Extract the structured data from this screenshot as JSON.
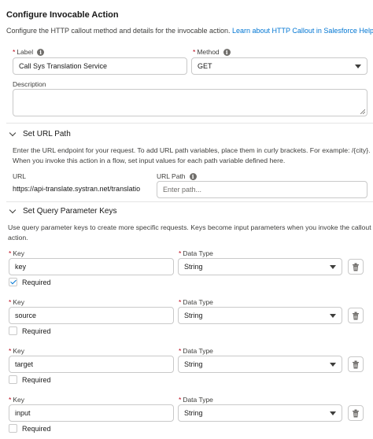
{
  "header": {
    "title": "Configure Invocable Action",
    "description": "Configure the HTTP callout method and details for the invocable action.",
    "help_link": "Learn about HTTP Callout in Salesforce Help."
  },
  "label_field": {
    "label": "Label",
    "value": "Call Sys Translation Service"
  },
  "method_field": {
    "label": "Method",
    "value": "GET"
  },
  "description_field": {
    "label": "Description",
    "value": ""
  },
  "url_section": {
    "title": "Set URL Path",
    "help_line1": "Enter the URL endpoint for your request. To add URL path variables, place them in curly brackets. For example: /{city}.",
    "help_line2": "When you invoke this action in a flow, set input values for each path variable defined here.",
    "url_label": "URL",
    "url_value": "https://api-translate.systran.net/translatio",
    "path_label": "URL Path",
    "path_placeholder": "Enter path..."
  },
  "query_section": {
    "title": "Set Query Parameter Keys",
    "help_line1": "Use query parameter keys to create more specific requests. Keys become input parameters when you invoke the callout",
    "help_line2": "action.",
    "key_label": "Key",
    "type_label": "Data Type",
    "required_label": "Required",
    "params": [
      {
        "key": "key",
        "type": "String",
        "required": true
      },
      {
        "key": "source",
        "type": "String",
        "required": false
      },
      {
        "key": "target",
        "type": "String",
        "required": false
      },
      {
        "key": "input",
        "type": "String",
        "required": false
      }
    ]
  },
  "icons": {
    "info": "info-icon",
    "chevron": "chevron-down-icon",
    "caret": "caret-down-icon",
    "delete": "trash-icon",
    "check": "checkmark-icon"
  },
  "colors": {
    "link": "#0176d3",
    "required": "#ba0517",
    "border": "#c9c9c9"
  }
}
